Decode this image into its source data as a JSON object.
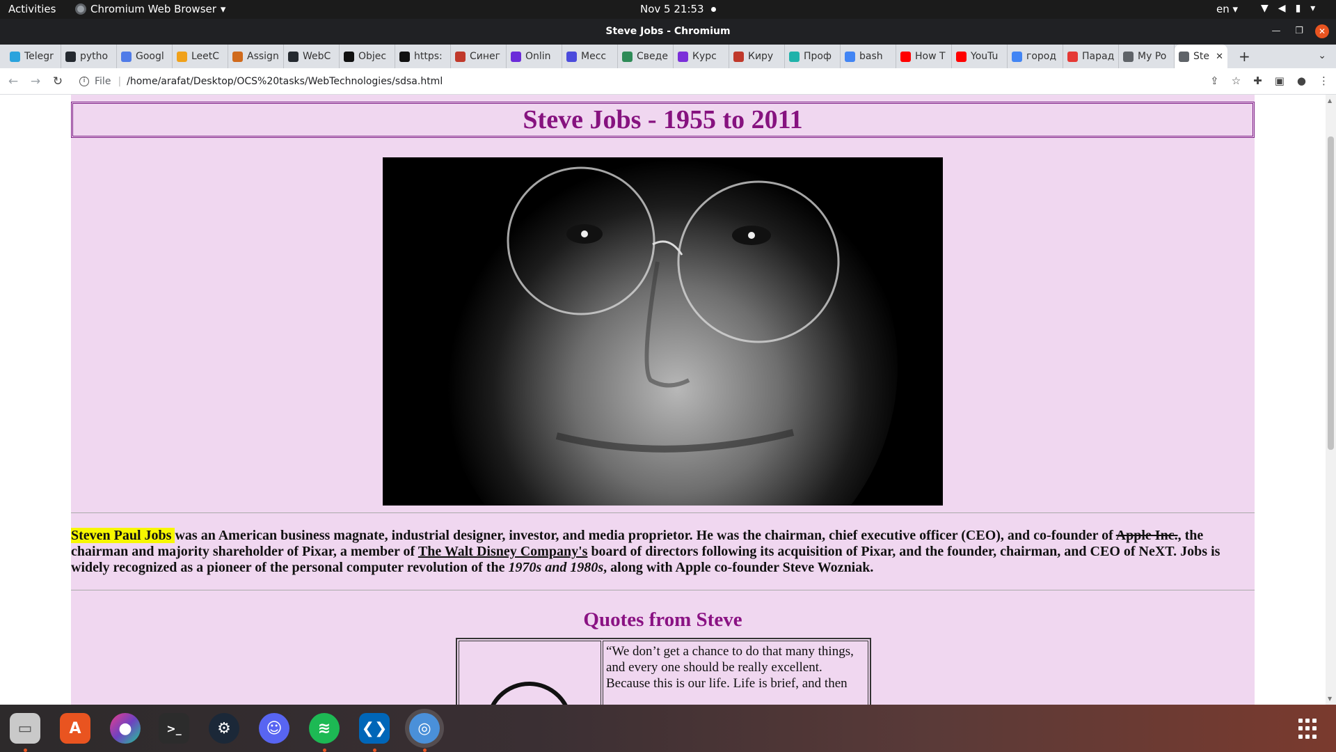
{
  "system": {
    "activities": "Activities",
    "app_menu": "Chromium Web Browser",
    "datetime": "Nov 5  21:53",
    "language": "en"
  },
  "window": {
    "title": "Steve Jobs - Chromium"
  },
  "tabs": [
    {
      "label": "Telegr",
      "color": "#2aa3dd"
    },
    {
      "label": "pytho",
      "color": "#24292f"
    },
    {
      "label": "Googl",
      "color": "#4f7be8"
    },
    {
      "label": "LeetC",
      "color": "#f0a11a"
    },
    {
      "label": "Assign",
      "color": "#d06a1c"
    },
    {
      "label": "WebC",
      "color": "#24292f"
    },
    {
      "label": "Objec",
      "color": "#111111"
    },
    {
      "label": "https:",
      "color": "#111111"
    },
    {
      "label": "Синег",
      "color": "#c0392b"
    },
    {
      "label": "Onlin",
      "color": "#6b2bd9"
    },
    {
      "label": "Месс",
      "color": "#4b4bdc"
    },
    {
      "label": "Сведе",
      "color": "#2e8b57"
    },
    {
      "label": "Курс",
      "color": "#7b2fd9"
    },
    {
      "label": "Киру",
      "color": "#c0392b"
    },
    {
      "label": "Проф",
      "color": "#20b2aa"
    },
    {
      "label": "bash",
      "color": "#4285f4"
    },
    {
      "label": "How T",
      "color": "#ff0000"
    },
    {
      "label": "YouTu",
      "color": "#ff0000"
    },
    {
      "label": "город",
      "color": "#4285f4"
    },
    {
      "label": "Парад",
      "color": "#e53935"
    },
    {
      "label": "My Po",
      "color": "#5f6368"
    },
    {
      "label": "Ste",
      "color": "#5f6368",
      "active": true
    }
  ],
  "address_bar": {
    "scheme_label": "File",
    "url": "/home/arafat/Desktop/OCS%20tasks/WebTechnologies/sdsa.html"
  },
  "page": {
    "heading": "Steve Jobs - 1955 to 2011",
    "bio": {
      "highlight": "Steven Paul Jobs ",
      "part1": "was an American business magnate, industrial designer, investor, and media proprietor. He was the chairman, chief executive officer (CEO), and co-founder of ",
      "strike": "Apple Inc.",
      "part2": ", the chairman and majority shareholder of Pixar, a member of ",
      "link": "The Walt Disney Company's",
      "part3": " board of directors following its acquisition of Pixar, and the founder, chairman, and CEO of NeXT. Jobs is widely recognized as a pioneer of the personal computer revolution of the ",
      "italic": "1970s and 1980s",
      "part4": ", along with Apple co-founder Steve Wozniak."
    },
    "quotes_title": "Quotes from Steve",
    "quote_text": "“We don’t get a chance to do that many things, and every one should be really excellent. Because this is our life. Life is brief, and then"
  },
  "colors": {
    "page_bg": "#f0d7f0",
    "heading": "#86127f",
    "highlight": "#f7f700",
    "accent": "#e95420"
  }
}
